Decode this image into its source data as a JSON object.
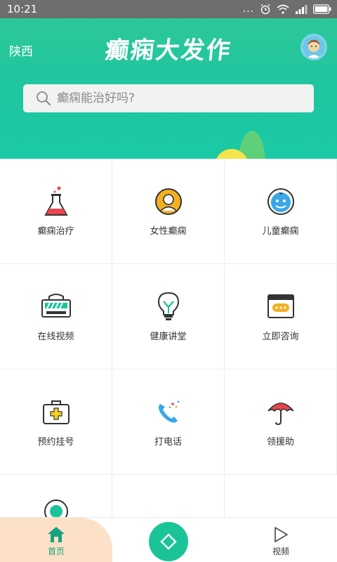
{
  "status_bar": {
    "time": "10:21",
    "dots": "..."
  },
  "header": {
    "region": "陕西",
    "title": "癫痫大发作",
    "search_placeholder": "癫痫能治好吗?"
  },
  "grid": {
    "items": [
      {
        "label": "癫痫治疗",
        "icon": "flask-icon"
      },
      {
        "label": "女性癫痫",
        "icon": "woman-icon"
      },
      {
        "label": "儿童癫痫",
        "icon": "child-face-icon"
      },
      {
        "label": "在线视频",
        "icon": "video-screen-icon"
      },
      {
        "label": "健康讲堂",
        "icon": "lightbulb-icon"
      },
      {
        "label": "立即咨询",
        "icon": "chat-window-icon"
      },
      {
        "label": "预约挂号",
        "icon": "medical-kit-icon"
      },
      {
        "label": "打电话",
        "icon": "phone-icon"
      },
      {
        "label": "领援助",
        "icon": "umbrella-icon"
      }
    ]
  },
  "bottom_nav": {
    "home_label": "首页",
    "video_label": "视频"
  },
  "colors": {
    "brand": "#1ec6a0",
    "active_tab_bg": "#fde0c8"
  }
}
